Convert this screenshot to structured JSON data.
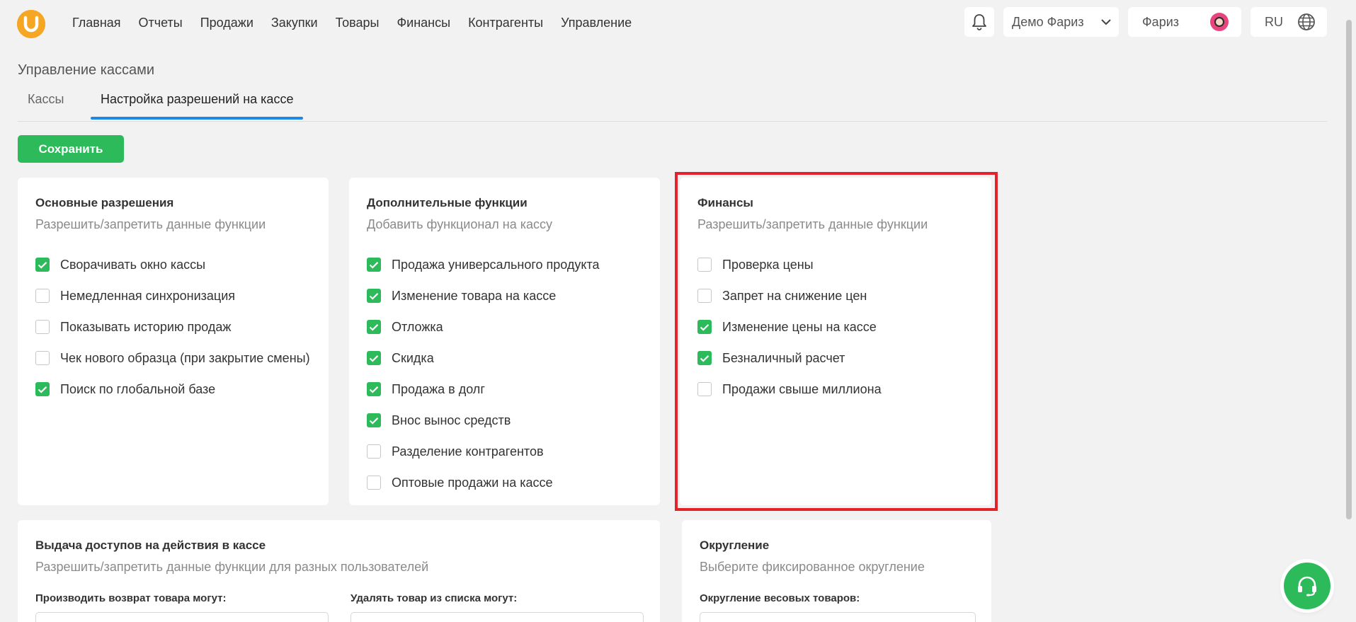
{
  "nav": {
    "items": [
      "Главная",
      "Отчеты",
      "Продажи",
      "Закупки",
      "Товары",
      "Финансы",
      "Контрагенты",
      "Управление"
    ],
    "company": "Демо Фариз",
    "user": "Фариз",
    "lang": "RU"
  },
  "page": {
    "title": "Управление кассами",
    "tabs": [
      "Кассы",
      "Настройка разрешений на кассе"
    ],
    "active_tab": "Настройка разрешений на кассе",
    "save_label": "Сохранить"
  },
  "basic": {
    "title": "Основные разрешения",
    "subtitle": "Разрешить/запретить данные функции",
    "items": [
      {
        "label": "Сворачивать окно кассы",
        "checked": true
      },
      {
        "label": "Немедленная синхронизация",
        "checked": false
      },
      {
        "label": "Показывать историю продаж",
        "checked": false
      },
      {
        "label": "Чек нового образца (при закрытие смены)",
        "checked": false
      },
      {
        "label": "Поиск по глобальной базе",
        "checked": true
      }
    ]
  },
  "extra": {
    "title": "Дополнительные функции",
    "subtitle": "Добавить функционал на кассу",
    "items": [
      {
        "label": "Продажа универсального продукта",
        "checked": true
      },
      {
        "label": "Изменение товара на кассе",
        "checked": true
      },
      {
        "label": "Отложка",
        "checked": true
      },
      {
        "label": "Скидка",
        "checked": true
      },
      {
        "label": "Продажа в долг",
        "checked": true
      },
      {
        "label": "Внос вынос средств",
        "checked": true
      },
      {
        "label": "Разделение контрагентов",
        "checked": false
      },
      {
        "label": "Оптовые продажи на кассе",
        "checked": false
      }
    ]
  },
  "finance": {
    "title": "Финансы",
    "subtitle": "Разрешить/запретить данные функции",
    "items": [
      {
        "label": "Проверка цены",
        "checked": false
      },
      {
        "label": "Запрет на снижение цен",
        "checked": false
      },
      {
        "label": "Изменение цены на кассе",
        "checked": true
      },
      {
        "label": "Безналичный расчет",
        "checked": true
      },
      {
        "label": "Продажи свыше миллиона",
        "checked": false
      }
    ]
  },
  "access": {
    "title": "Выдача доступов на действия в кассе",
    "subtitle": "Разрешить/запретить данные функции для разных пользователей",
    "return_label": "Производить возврат товара могут:",
    "delete_label": "Удалять товар из списка могут:"
  },
  "rounding": {
    "title": "Округление",
    "subtitle": "Выберите фиксированное округление",
    "weight_label": "Округление весовых товаров:"
  },
  "colors": {
    "accent_green": "#2dba5a",
    "tab_blue": "#1e88e5",
    "highlight_red": "#e3222b",
    "logo_orange": "#f5a623"
  }
}
